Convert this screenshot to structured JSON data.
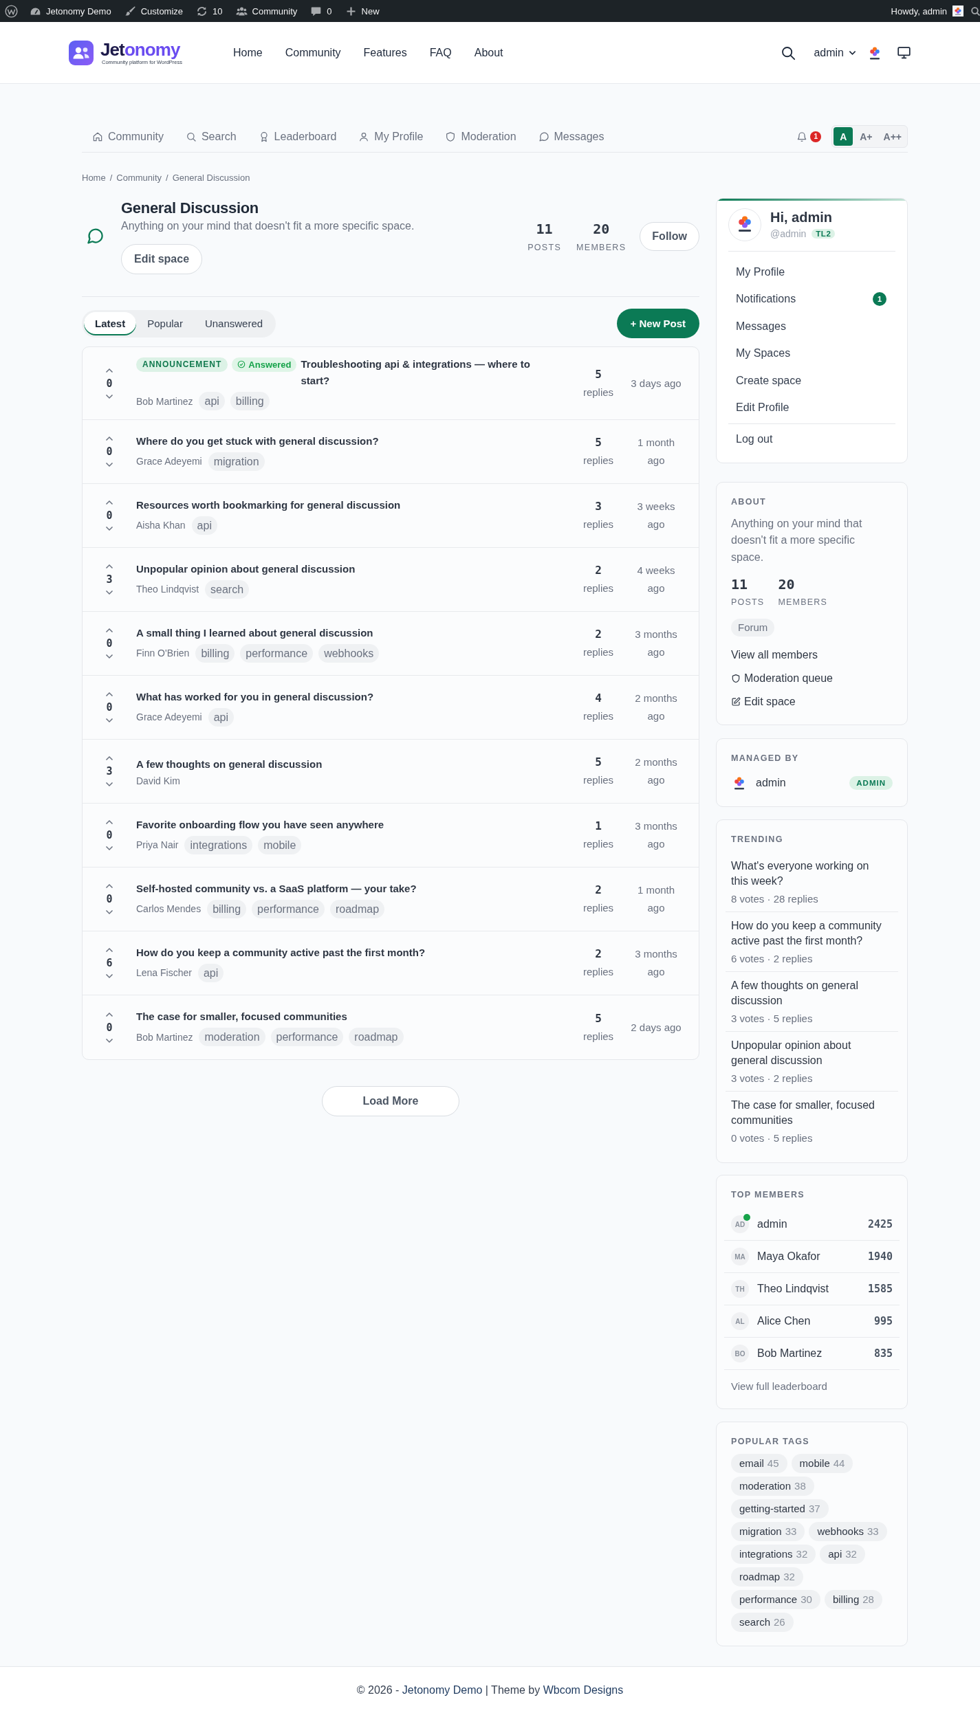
{
  "admin_bar": {
    "items": [
      {
        "kind": "site",
        "label": "Jetonomy Demo"
      },
      {
        "kind": "customize",
        "label": "Customize"
      },
      {
        "kind": "updates",
        "label": "10"
      },
      {
        "kind": "community",
        "label": "Community"
      },
      {
        "kind": "comments",
        "label": "0"
      },
      {
        "kind": "new",
        "label": "New"
      }
    ],
    "greeting": "Howdy, admin"
  },
  "header": {
    "logo": {
      "name_parts": [
        {
          "kind": "plain",
          "text": "Jet"
        },
        {
          "kind": "accent",
          "text": "onomy"
        }
      ],
      "tagline": "Community platform for WordPress"
    },
    "nav": [
      "Home",
      "Community",
      "Features",
      "FAQ",
      "About"
    ],
    "user_menu": "admin"
  },
  "community_nav": {
    "items": [
      {
        "kind": "home",
        "label": "Community"
      },
      {
        "kind": "search",
        "label": "Search"
      },
      {
        "kind": "award",
        "label": "Leaderboard"
      },
      {
        "kind": "person",
        "label": "My Profile"
      },
      {
        "kind": "shield",
        "label": "Moderation"
      },
      {
        "kind": "chat",
        "label": "Messages"
      }
    ],
    "notification_count": "1",
    "font_sizes": [
      {
        "label": "A",
        "selected": true
      },
      {
        "label": "A+",
        "selected": false
      },
      {
        "label": "A++",
        "selected": false
      }
    ]
  },
  "breadcrumb": [
    {
      "kind": "link",
      "label": "Home"
    },
    {
      "kind": "separator",
      "label": "/"
    },
    {
      "kind": "link",
      "label": "Community"
    },
    {
      "kind": "separator",
      "label": "/"
    },
    {
      "kind": "current",
      "label": "General Discussion"
    }
  ],
  "space": {
    "title": "General Discussion",
    "description": "Anything on your mind that doesn't fit a more specific space.",
    "edit_button": "Edit space",
    "stats": [
      {
        "value": "11",
        "label": "POSTS"
      },
      {
        "value": "20",
        "label": "MEMBERS"
      }
    ],
    "follow_button": "Follow"
  },
  "feed": {
    "tabs": [
      {
        "label": "Latest",
        "selected": true
      },
      {
        "label": "Popular",
        "selected": false
      },
      {
        "label": "Unanswered",
        "selected": false
      }
    ],
    "new_post_button": "+ New Post",
    "posts": [
      {
        "votes": "0",
        "badges": [
          {
            "kind": "announcement",
            "label": "ANNOUNCEMENT"
          },
          {
            "kind": "answered",
            "label": "Answered"
          }
        ],
        "title": "Troubleshooting api & integrations — where to start?",
        "author": "Bob Martinez",
        "tags": [
          "api",
          "billing"
        ],
        "replies": "5",
        "replies_label": "replies",
        "time": "3 days ago"
      },
      {
        "votes": "0",
        "title": "Where do you get stuck with general discussion?",
        "author": "Grace Adeyemi",
        "tags": [
          "migration"
        ],
        "replies": "5",
        "replies_label": "replies",
        "time": "1 month ago"
      },
      {
        "votes": "0",
        "title": "Resources worth bookmarking for general discussion",
        "author": "Aisha Khan",
        "tags": [
          "api"
        ],
        "replies": "3",
        "replies_label": "replies",
        "time": "3 weeks ago"
      },
      {
        "votes": "3",
        "title": "Unpopular opinion about general discussion",
        "author": "Theo Lindqvist",
        "tags": [
          "search"
        ],
        "replies": "2",
        "replies_label": "replies",
        "time": "4 weeks ago"
      },
      {
        "votes": "0",
        "title": "A small thing I learned about general discussion",
        "author": "Finn O'Brien",
        "tags": [
          "billing",
          "performance",
          "webhooks"
        ],
        "replies": "2",
        "replies_label": "replies",
        "time": "3 months ago"
      },
      {
        "votes": "0",
        "title": "What has worked for you in general discussion?",
        "author": "Grace Adeyemi",
        "tags": [
          "api"
        ],
        "replies": "4",
        "replies_label": "replies",
        "time": "2 months ago"
      },
      {
        "votes": "3",
        "title": "A few thoughts on general discussion",
        "author": "David Kim",
        "replies": "5",
        "replies_label": "replies",
        "time": "2 months ago"
      },
      {
        "votes": "0",
        "title": "Favorite onboarding flow you have seen anywhere",
        "author": "Priya Nair",
        "tags": [
          "integrations",
          "mobile"
        ],
        "replies": "1",
        "replies_label": "replies",
        "time": "3 months ago"
      },
      {
        "votes": "0",
        "title": "Self-hosted community vs. a SaaS platform — your take?",
        "author": "Carlos Mendes",
        "tags": [
          "billing",
          "performance",
          "roadmap"
        ],
        "replies": "2",
        "replies_label": "replies",
        "time": "1 month ago"
      },
      {
        "votes": "6",
        "title": "How do you keep a community active past the first month?",
        "author": "Lena Fischer",
        "tags": [
          "api"
        ],
        "replies": "2",
        "replies_label": "replies",
        "time": "3 months ago"
      },
      {
        "votes": "0",
        "title": "The case for smaller, focused communities",
        "author": "Bob Martinez",
        "tags": [
          "moderation",
          "performance",
          "roadmap"
        ],
        "replies": "5",
        "replies_label": "replies",
        "time": "2 days ago"
      }
    ],
    "load_more": "Load More"
  },
  "sidebar": {
    "profile": {
      "greeting": "Hi, admin",
      "handle": "@admin",
      "trust_level": "TL2",
      "menu": [
        {
          "label": "My Profile"
        },
        {
          "label": "Notifications",
          "badge": "1"
        },
        {
          "label": "Messages"
        },
        {
          "label": "My Spaces"
        },
        {
          "label": "Create space"
        },
        {
          "label": "Edit Profile"
        }
      ],
      "logout": "Log out"
    },
    "about": {
      "heading": "ABOUT",
      "description": "Anything on your mind that doesn't fit a more specific space.",
      "stats": [
        {
          "value": "11",
          "label": "POSTS"
        },
        {
          "value": "20",
          "label": "MEMBERS"
        }
      ],
      "space_type": "Forum",
      "links": [
        {
          "kind": "members",
          "label": "View all members"
        },
        {
          "kind": "moderation",
          "label": "Moderation queue"
        },
        {
          "kind": "edit",
          "label": "Edit space"
        }
      ]
    },
    "managed_by": {
      "heading": "MANAGED BY",
      "name": "admin",
      "role": "ADMIN"
    },
    "trending": {
      "heading": "TRENDING",
      "items": [
        {
          "title": "What's everyone working on this week?",
          "meta": "8 votes · 28 replies"
        },
        {
          "title": "How do you keep a community active past the first month?",
          "meta": "6 votes · 2 replies"
        },
        {
          "title": "A few thoughts on general discussion",
          "meta": "3 votes · 5 replies"
        },
        {
          "title": "Unpopular opinion about general discussion",
          "meta": "3 votes · 2 replies"
        },
        {
          "title": "The case for smaller, focused communities",
          "meta": "0 votes · 5 replies"
        }
      ]
    },
    "top_members": {
      "heading": "TOP MEMBERS",
      "members": [
        {
          "initials": "AD",
          "name": "admin",
          "points": "2425",
          "online": true
        },
        {
          "initials": "MA",
          "name": "Maya Okafor",
          "points": "1940",
          "online": false
        },
        {
          "initials": "TH",
          "name": "Theo Lindqvist",
          "points": "1585",
          "online": false
        },
        {
          "initials": "AL",
          "name": "Alice Chen",
          "points": "995",
          "online": false
        },
        {
          "initials": "BO",
          "name": "Bob Martinez",
          "points": "835",
          "online": false
        }
      ],
      "link": "View full leaderboard"
    },
    "popular_tags": {
      "heading": "POPULAR TAGS",
      "tags": [
        {
          "name": "email",
          "count": "45"
        },
        {
          "name": "mobile",
          "count": "44"
        },
        {
          "name": "moderation",
          "count": "38"
        },
        {
          "name": "getting-started",
          "count": "37"
        },
        {
          "name": "migration",
          "count": "33"
        },
        {
          "name": "webhooks",
          "count": "33"
        },
        {
          "name": "integrations",
          "count": "32"
        },
        {
          "name": "api",
          "count": "32"
        },
        {
          "name": "roadmap",
          "count": "32"
        },
        {
          "name": "performance",
          "count": "30"
        },
        {
          "name": "billing",
          "count": "28"
        },
        {
          "name": "search",
          "count": "26"
        }
      ]
    }
  },
  "footer": {
    "copyright": "© 2026 -",
    "site_link": "Jetonomy Demo",
    "theme_prefix": "| Theme by",
    "theme_link": "Wbcom Designs"
  }
}
